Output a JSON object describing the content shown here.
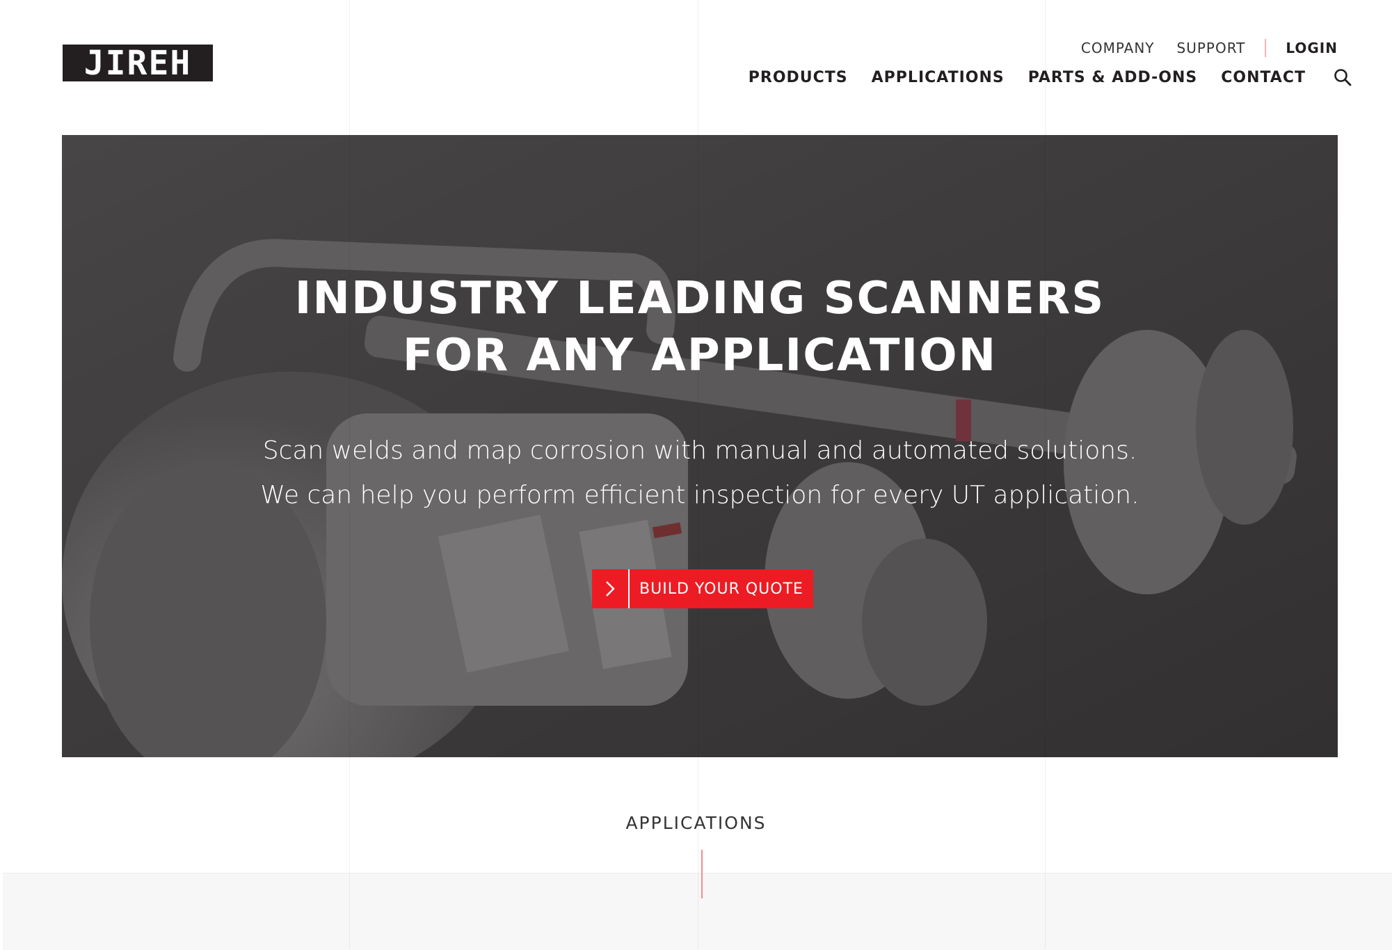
{
  "header": {
    "logo_text": "JIREH",
    "util_nav": {
      "company": "COMPANY",
      "support": "SUPPORT",
      "login": "LOGIN"
    },
    "main_nav": {
      "products": "PRODUCTS",
      "applications": "APPLICATIONS",
      "parts": "PARTS & ADD-ONS",
      "contact": "CONTACT"
    },
    "search_icon": "search-icon"
  },
  "hero": {
    "title_line1": "INDUSTRY LEADING SCANNERS",
    "title_line2": "FOR ANY APPLICATION",
    "subtitle_line1": "Scan welds and map corrosion with manual and automated solutions.",
    "subtitle_line2": "We can help you perform efficient inspection for every UT application.",
    "cta_label": "BUILD YOUR QUOTE",
    "cta_icon": "chevron-right-icon"
  },
  "section": {
    "label": "APPLICATIONS"
  },
  "colors": {
    "accent": "#ed1c24",
    "dark": "#231f20",
    "separator": "#f3b2b6"
  }
}
